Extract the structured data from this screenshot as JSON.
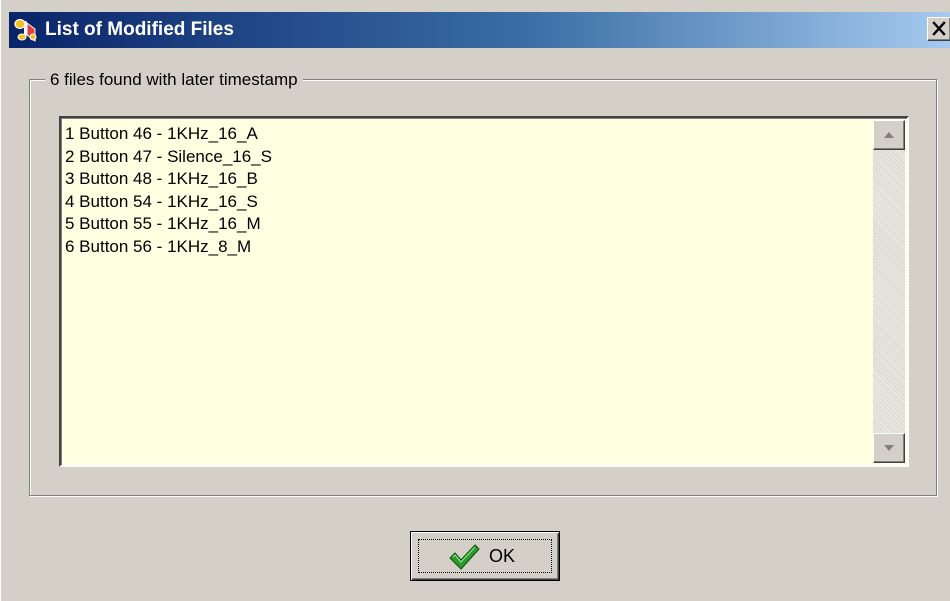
{
  "window": {
    "title": "List of Modified Files",
    "icon": "music-notes-app-icon",
    "close_icon": "close-x-icon"
  },
  "group": {
    "label": "6 files found with later timestamp"
  },
  "files": [
    "1 Button 46 - 1KHz_16_A",
    "2 Button 47 - Silence_16_S",
    "3 Button 48 - 1KHz_16_B",
    "4 Button 54 - 1KHz_16_S",
    "5 Button 55 - 1KHz_16_M",
    "6 Button 56 - 1KHz_8_M"
  ],
  "ok_button": {
    "label": "OK",
    "icon": "green-checkmark-icon"
  },
  "colors": {
    "title_start": "#0a246a",
    "title_end": "#a6caf0",
    "list_background": "#ffffe1",
    "dialog_face": "#d4d0c8",
    "checkmark": "#2e9a2e"
  }
}
